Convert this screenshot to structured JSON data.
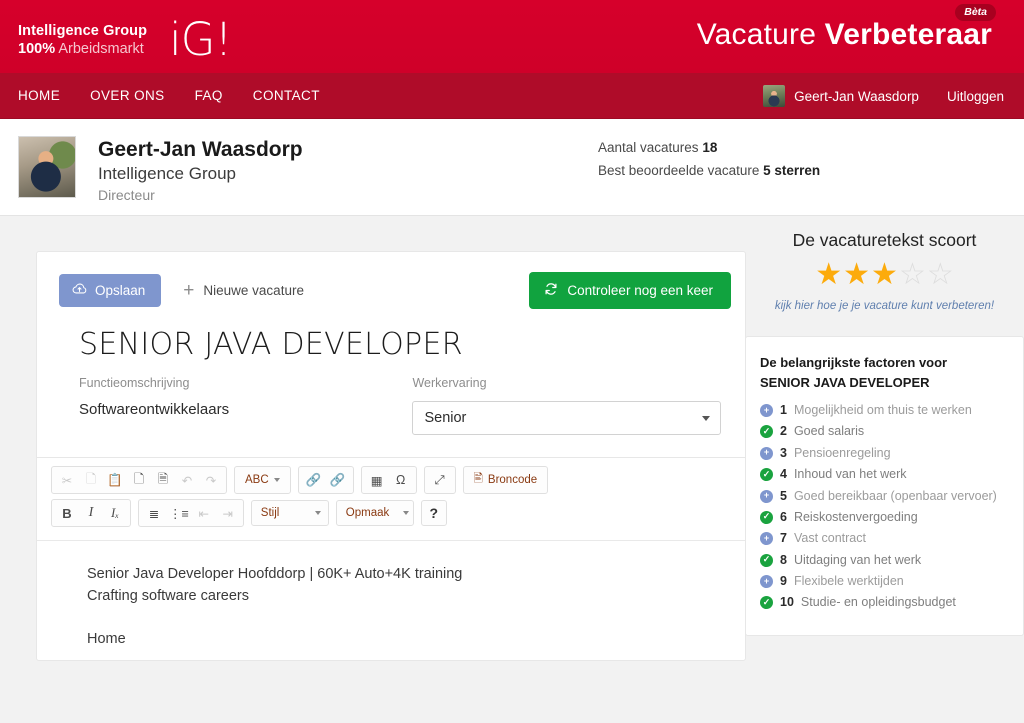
{
  "brand": {
    "line1": "Intelligence Group",
    "percent": "100%",
    "line2_rest": " Arbeidsmarkt",
    "logo": "iG!"
  },
  "header": {
    "app_title_light": "Vacature ",
    "app_title_bold": "Verbeteraar",
    "beta_label": "Bèta",
    "accent_top": "#d4002a",
    "accent_nav": "#af0c29"
  },
  "nav": {
    "items": [
      {
        "label": "HOME"
      },
      {
        "label": "OVER ONS"
      },
      {
        "label": "FAQ"
      },
      {
        "label": "CONTACT"
      }
    ],
    "username": "Geert-Jan Waasdorp",
    "logout": "Uitloggen"
  },
  "profile": {
    "name": "Geert-Jan Waasdorp",
    "organisation": "Intelligence Group",
    "role": "Directeur",
    "stats": [
      {
        "label": "Aantal vacatures ",
        "value": "18"
      },
      {
        "label": "Best beoordeelde vacature ",
        "value": "5 sterren"
      }
    ]
  },
  "toolbar": {
    "save_label": "Opslaan",
    "new_label": "Nieuwe vacature",
    "check_label": "Controleer nog een keer"
  },
  "vacancy": {
    "title": "SENIOR JAVA DEVELOPER",
    "fields": {
      "function_label": "Functieomschrijving",
      "function_value": "Softwareontwikkelaars",
      "experience_label": "Werkervaring",
      "experience_value": "Senior"
    }
  },
  "editor": {
    "row1": [
      {
        "name": "cut-icon",
        "glyph": "✂",
        "dim": true
      },
      {
        "name": "copy-icon",
        "glyph": "❐",
        "dim": true
      },
      {
        "name": "paste-icon",
        "glyph": "ὌB",
        "dim": false
      },
      {
        "name": "paste-text-icon",
        "glyph": "T",
        "dim": false
      },
      {
        "name": "paste-word-icon",
        "glyph": "W",
        "dim": false
      },
      {
        "name": "undo-icon",
        "glyph": "↶",
        "dim": true
      },
      {
        "name": "redo-icon",
        "glyph": "↷",
        "dim": true
      }
    ],
    "spellcheck_label": "ABC",
    "link_label": "link",
    "unlink_label": "unlink",
    "table_label": "table",
    "omega_label": "Ω",
    "maximize_label": "maximize",
    "source_label": "Broncode",
    "bold_label": "B",
    "italic_label": "I",
    "removeformat_label": "Iₓ",
    "numlist_label": "numbered-list",
    "bullist_label": "bulleted-list",
    "outdent_label": "outdent",
    "indent_label": "indent",
    "style_label": "Stijl",
    "format_label": "Opmaak",
    "help_label": "?",
    "content_line1": "Senior Java Developer Hoofddorp | 60K+ Auto+4K training",
    "content_line2": "Crafting software careers",
    "content_line3": "Home"
  },
  "score": {
    "title": "De vacaturetekst scoort",
    "rating": 3,
    "max_rating": 5,
    "star_on_color": "#fcab0c",
    "star_off_color": "#dddddd",
    "link": "kijk hier hoe je je vacature kunt verbeteren!"
  },
  "factors": {
    "heading_line1": "De belangrijkste factoren voor",
    "heading_line2": "SENIOR JAVA DEVELOPER",
    "items": [
      {
        "num": "1",
        "text": "Mogelijkheid om thuis te werken",
        "state": "add"
      },
      {
        "num": "2",
        "text": "Goed salaris",
        "state": "ok"
      },
      {
        "num": "3",
        "text": "Pensioenregeling",
        "state": "add"
      },
      {
        "num": "4",
        "text": "Inhoud van het werk",
        "state": "ok"
      },
      {
        "num": "5",
        "text": "Goed bereikbaar (openbaar vervoer)",
        "state": "add"
      },
      {
        "num": "6",
        "text": "Reiskostenvergoeding",
        "state": "ok"
      },
      {
        "num": "7",
        "text": "Vast contract",
        "state": "add"
      },
      {
        "num": "8",
        "text": "Uitdaging van het werk",
        "state": "ok"
      },
      {
        "num": "9",
        "text": "Flexibele werktijden",
        "state": "add"
      },
      {
        "num": "10",
        "text": "Studie- en opleidingsbudget",
        "state": "ok"
      }
    ]
  }
}
